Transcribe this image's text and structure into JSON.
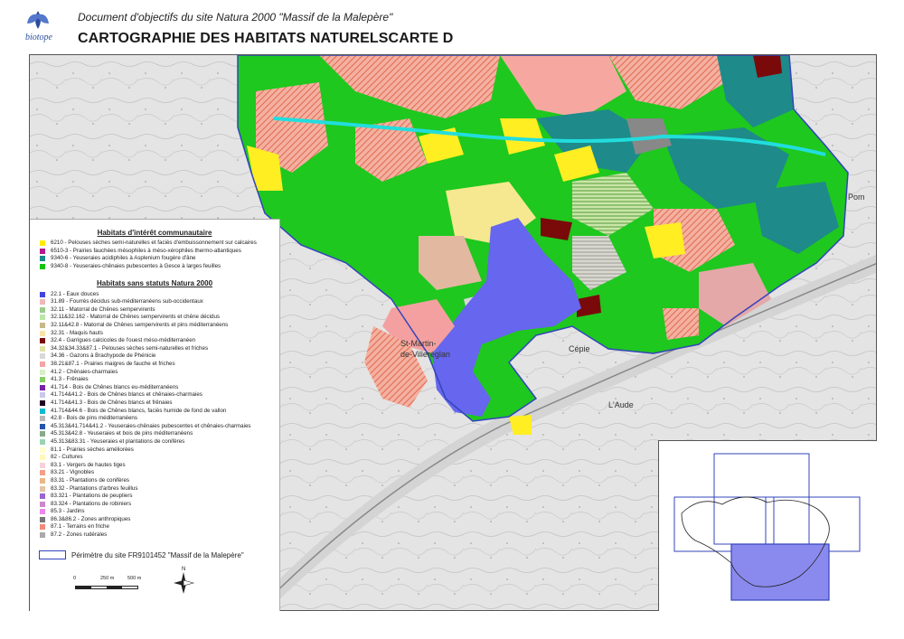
{
  "header": {
    "logo_text": "biotope",
    "subtitle": "Document d'objectifs du site Natura 2000 \"Massif de la Malepère\"",
    "title": "CARTOGRAPHIE DES HABITATS NATURELSCARTE D"
  },
  "map": {
    "place_labels": {
      "st_martin": "St-Martin-",
      "villereglan": "de-Villeréglan",
      "cepie": "Cépie",
      "aude": "L'Aude",
      "pom": "Pom"
    }
  },
  "legend": {
    "section1_title": "Habitats d'intérêt communautaire",
    "section1_items": [
      {
        "label": "6210 - Pelouses sèches semi-naturelles et faciès d'embuissonnement sur calcaires",
        "color": "#ffee00"
      },
      {
        "label": "6510-3 - Prairies fauchées mésophiles à méso-xérophiles thermo-atlantiques",
        "color": "#b51c8a"
      },
      {
        "label": "9340-6 - Yeuseraies acidiphiles à Asplenium fougère d'âne",
        "color": "#1b8a8a"
      },
      {
        "label": "9340-8 - Yeuseraies-chênaies pubescentes à Gesce à larges feuilles",
        "color": "#11c411"
      }
    ],
    "section2_title": "Habitats sans statuts Natura 2000",
    "section2_items": [
      {
        "label": "22.1 - Eaux douces",
        "color": "#4444dd"
      },
      {
        "label": "31.89 - Fourrés décidus sub-méditerranéens sub-occidentaux",
        "color": "#f2b8b8"
      },
      {
        "label": "32.11 - Matorral de Chênes sempervirents",
        "color": "#9acd8a"
      },
      {
        "label": "32.11&32.162 - Matorral de Chênes sempervirents et chêne décidus",
        "color": "#b8e6a8"
      },
      {
        "label": "32.11&42.8 - Matorral de Chênes sempervirents et pins méditerranéens",
        "color": "#c8b88a"
      },
      {
        "label": "32.31 - Maquis hauts",
        "color": "#f8e4a8"
      },
      {
        "label": "32.4 - Garrigues calcicoles de l'ouest méso-méditerranéen",
        "color": "#7a0a0a"
      },
      {
        "label": "34.32&34.33&87.1 - Pelouses sèches semi-naturelles et friches",
        "color": "#e2e2a8"
      },
      {
        "label": "34.36 - Gazons à Brachypode de Phénicie",
        "color": "#d8d8d8"
      },
      {
        "label": "38.21&87.1 - Prairies maigres de fauche et friches",
        "color": "#f4a4a4"
      },
      {
        "label": "41.2 - Chênaies-charmaies",
        "color": "#d8f0c8"
      },
      {
        "label": "41.3 - Frênaies",
        "color": "#88cc66"
      },
      {
        "label": "41.714 - Bois de Chênes blancs eu-méditerranéens",
        "color": "#7722aa"
      },
      {
        "label": "41.714&41.2 - Bois de Chênes blancs et chênaies-charmaies",
        "color": "#c8c8e8"
      },
      {
        "label": "41.714&41.3 - Bois de Chênes blancs et frênaies",
        "color": "#220022"
      },
      {
        "label": "41.714&44.6 - Bois de Chênes blancs, faciès humide de fond de vallon",
        "color": "#11bbcc"
      },
      {
        "label": "42.8 - Bois de pins méditerranéens",
        "color": "#b8b8b8"
      },
      {
        "label": "45.313&41.714&41.2 - Yeuseraies-chênaies pubescentes et chênaies-charmaies",
        "color": "#2255aa"
      },
      {
        "label": "45.313&42.8 - Yeuseraies et bois de pins méditerranéens",
        "color": "#88aa88"
      },
      {
        "label": "45.313&83.31 - Yeuseraies et plantations de conifères",
        "color": "#9ad4b4"
      },
      {
        "label": "81.1 - Prairies sèches améliorées",
        "color": "#ffffcc"
      },
      {
        "label": "82 - Cultures",
        "color": "#fff8b8"
      },
      {
        "label": "83.1 - Vergers de hautes tiges",
        "color": "#f8d0d8"
      },
      {
        "label": "83.21 - Vignobles",
        "color": "#f2a088"
      },
      {
        "label": "83.31 - Plantations de conifères",
        "color": "#e8b888"
      },
      {
        "label": "83.32 - Plantations d'arbres feuillus",
        "color": "#e4c4a4"
      },
      {
        "label": "83.321 - Plantations de peupliers",
        "color": "#9966cc"
      },
      {
        "label": "83.324 - Plantations de robiniers",
        "color": "#cc88cc"
      },
      {
        "label": "85.3 - Jardins",
        "color": "#ee88ee"
      },
      {
        "label": "86.3&86.2 - Zones anthropiques",
        "color": "#777777"
      },
      {
        "label": "87.1 - Terrains en friche",
        "color": "#f08a7a"
      },
      {
        "label": "87.2 - Zones rudérales",
        "color": "#aaaaaa"
      }
    ],
    "perimeter_label": "Périmètre du site FR9101452 \"Massif de la Malepère\"",
    "scale_labels": [
      "0",
      "250 m",
      "500 m"
    ],
    "north_label": "N"
  },
  "colors": {
    "perimeter": "#3344bb",
    "inset_fill": "#8a8aee"
  }
}
